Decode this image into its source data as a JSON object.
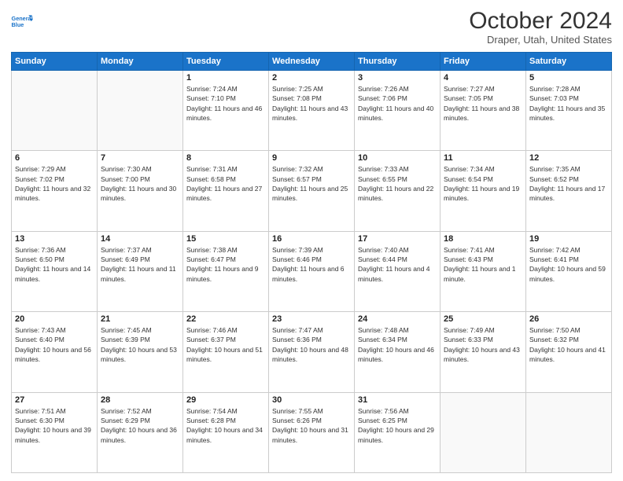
{
  "header": {
    "logo_line1": "General",
    "logo_line2": "Blue",
    "title": "October 2024",
    "subtitle": "Draper, Utah, United States"
  },
  "weekdays": [
    "Sunday",
    "Monday",
    "Tuesday",
    "Wednesday",
    "Thursday",
    "Friday",
    "Saturday"
  ],
  "weeks": [
    [
      {
        "day": "",
        "info": ""
      },
      {
        "day": "",
        "info": ""
      },
      {
        "day": "1",
        "info": "Sunrise: 7:24 AM\nSunset: 7:10 PM\nDaylight: 11 hours and 46 minutes."
      },
      {
        "day": "2",
        "info": "Sunrise: 7:25 AM\nSunset: 7:08 PM\nDaylight: 11 hours and 43 minutes."
      },
      {
        "day": "3",
        "info": "Sunrise: 7:26 AM\nSunset: 7:06 PM\nDaylight: 11 hours and 40 minutes."
      },
      {
        "day": "4",
        "info": "Sunrise: 7:27 AM\nSunset: 7:05 PM\nDaylight: 11 hours and 38 minutes."
      },
      {
        "day": "5",
        "info": "Sunrise: 7:28 AM\nSunset: 7:03 PM\nDaylight: 11 hours and 35 minutes."
      }
    ],
    [
      {
        "day": "6",
        "info": "Sunrise: 7:29 AM\nSunset: 7:02 PM\nDaylight: 11 hours and 32 minutes."
      },
      {
        "day": "7",
        "info": "Sunrise: 7:30 AM\nSunset: 7:00 PM\nDaylight: 11 hours and 30 minutes."
      },
      {
        "day": "8",
        "info": "Sunrise: 7:31 AM\nSunset: 6:58 PM\nDaylight: 11 hours and 27 minutes."
      },
      {
        "day": "9",
        "info": "Sunrise: 7:32 AM\nSunset: 6:57 PM\nDaylight: 11 hours and 25 minutes."
      },
      {
        "day": "10",
        "info": "Sunrise: 7:33 AM\nSunset: 6:55 PM\nDaylight: 11 hours and 22 minutes."
      },
      {
        "day": "11",
        "info": "Sunrise: 7:34 AM\nSunset: 6:54 PM\nDaylight: 11 hours and 19 minutes."
      },
      {
        "day": "12",
        "info": "Sunrise: 7:35 AM\nSunset: 6:52 PM\nDaylight: 11 hours and 17 minutes."
      }
    ],
    [
      {
        "day": "13",
        "info": "Sunrise: 7:36 AM\nSunset: 6:50 PM\nDaylight: 11 hours and 14 minutes."
      },
      {
        "day": "14",
        "info": "Sunrise: 7:37 AM\nSunset: 6:49 PM\nDaylight: 11 hours and 11 minutes."
      },
      {
        "day": "15",
        "info": "Sunrise: 7:38 AM\nSunset: 6:47 PM\nDaylight: 11 hours and 9 minutes."
      },
      {
        "day": "16",
        "info": "Sunrise: 7:39 AM\nSunset: 6:46 PM\nDaylight: 11 hours and 6 minutes."
      },
      {
        "day": "17",
        "info": "Sunrise: 7:40 AM\nSunset: 6:44 PM\nDaylight: 11 hours and 4 minutes."
      },
      {
        "day": "18",
        "info": "Sunrise: 7:41 AM\nSunset: 6:43 PM\nDaylight: 11 hours and 1 minute."
      },
      {
        "day": "19",
        "info": "Sunrise: 7:42 AM\nSunset: 6:41 PM\nDaylight: 10 hours and 59 minutes."
      }
    ],
    [
      {
        "day": "20",
        "info": "Sunrise: 7:43 AM\nSunset: 6:40 PM\nDaylight: 10 hours and 56 minutes."
      },
      {
        "day": "21",
        "info": "Sunrise: 7:45 AM\nSunset: 6:39 PM\nDaylight: 10 hours and 53 minutes."
      },
      {
        "day": "22",
        "info": "Sunrise: 7:46 AM\nSunset: 6:37 PM\nDaylight: 10 hours and 51 minutes."
      },
      {
        "day": "23",
        "info": "Sunrise: 7:47 AM\nSunset: 6:36 PM\nDaylight: 10 hours and 48 minutes."
      },
      {
        "day": "24",
        "info": "Sunrise: 7:48 AM\nSunset: 6:34 PM\nDaylight: 10 hours and 46 minutes."
      },
      {
        "day": "25",
        "info": "Sunrise: 7:49 AM\nSunset: 6:33 PM\nDaylight: 10 hours and 43 minutes."
      },
      {
        "day": "26",
        "info": "Sunrise: 7:50 AM\nSunset: 6:32 PM\nDaylight: 10 hours and 41 minutes."
      }
    ],
    [
      {
        "day": "27",
        "info": "Sunrise: 7:51 AM\nSunset: 6:30 PM\nDaylight: 10 hours and 39 minutes."
      },
      {
        "day": "28",
        "info": "Sunrise: 7:52 AM\nSunset: 6:29 PM\nDaylight: 10 hours and 36 minutes."
      },
      {
        "day": "29",
        "info": "Sunrise: 7:54 AM\nSunset: 6:28 PM\nDaylight: 10 hours and 34 minutes."
      },
      {
        "day": "30",
        "info": "Sunrise: 7:55 AM\nSunset: 6:26 PM\nDaylight: 10 hours and 31 minutes."
      },
      {
        "day": "31",
        "info": "Sunrise: 7:56 AM\nSunset: 6:25 PM\nDaylight: 10 hours and 29 minutes."
      },
      {
        "day": "",
        "info": ""
      },
      {
        "day": "",
        "info": ""
      }
    ]
  ]
}
